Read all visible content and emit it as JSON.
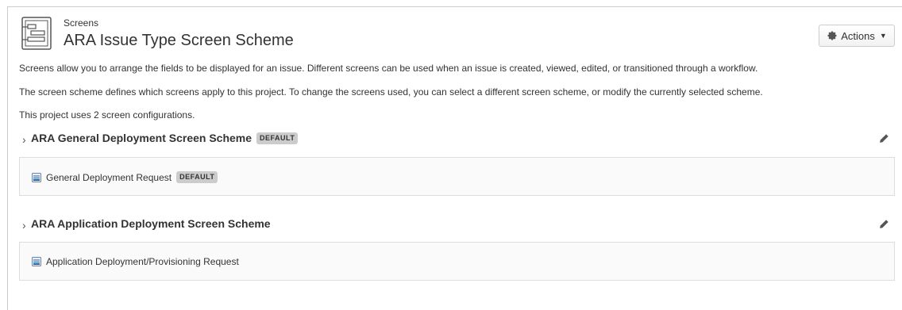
{
  "header": {
    "subtitle": "Screens",
    "title": "ARA Issue Type Screen Scheme",
    "icon": "screen-scheme-icon",
    "actions_label": "Actions"
  },
  "description": {
    "line1": "Screens allow you to arrange the fields to be displayed for an issue. Different screens can be used when an issue is created, viewed, edited, or transitioned through a workflow.",
    "line2": "The screen scheme defines which screens apply to this project. To change the screens used, you can select a different screen scheme, or modify the currently selected scheme.",
    "line3": "This project uses 2 screen configurations."
  },
  "schemes": [
    {
      "title": "ARA General Deployment Screen Scheme",
      "badge": "DEFAULT",
      "screen": {
        "label": "General Deployment Request",
        "badge": "DEFAULT"
      }
    },
    {
      "title": "ARA Application Deployment Screen Scheme",
      "screen": {
        "label": "Application Deployment/Provisioning Request"
      }
    }
  ],
  "colors": {
    "badge_bg": "#cccccc",
    "border": "#dddddd",
    "text": "#333333"
  }
}
